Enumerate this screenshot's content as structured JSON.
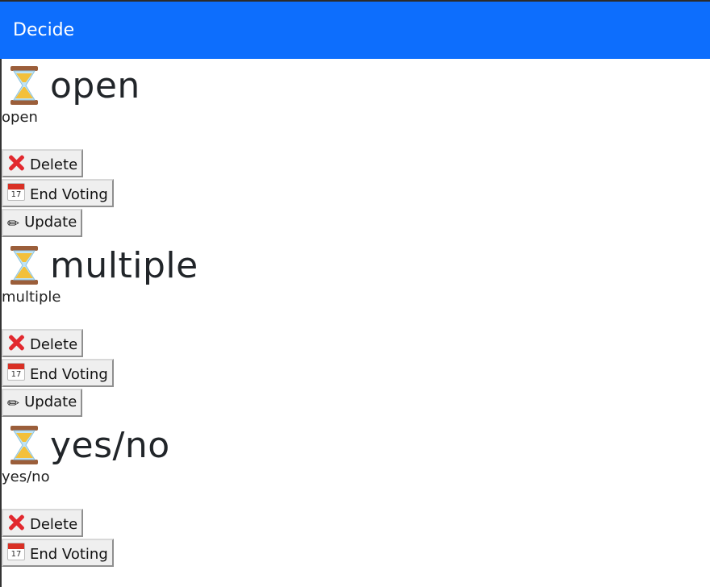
{
  "navbar": {
    "title": "Decide"
  },
  "polls": [
    {
      "title": "open",
      "description": "open",
      "buttons": {
        "delete": "Delete",
        "end_voting": "End Voting",
        "update": "Update"
      }
    },
    {
      "title": "multiple",
      "description": "multiple",
      "buttons": {
        "delete": "Delete",
        "end_voting": "End Voting",
        "update": "Update"
      }
    },
    {
      "title": "yes/no",
      "description": "yes/no",
      "buttons": {
        "delete": "Delete",
        "end_voting": "End Voting"
      }
    }
  ],
  "icons": {
    "status": "hourglass-icon",
    "delete": "cross-mark-icon",
    "end_voting": "calendar-icon",
    "update": "pencil-icon",
    "calendar_day": "17"
  },
  "colors": {
    "navbar": "#0d6efd",
    "delete_icon": "#e2282e"
  }
}
